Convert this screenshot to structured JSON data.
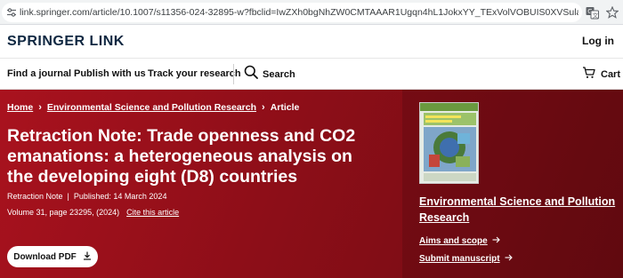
{
  "browser": {
    "url": "link.springer.com/article/10.1007/s11356-024-32895-w?fbclid=IwZXh0bgNhZW0CMTAAAR1Ugqn4hL1JokxYY_TExVolVOBUIS0XVSulaxiA_oratL5an3qFRZwtyI_aem_Acla6Zhy67Glz4Uc_iuc-zO..."
  },
  "header": {
    "logo": "SPRINGER LINK",
    "login": "Log in"
  },
  "nav": {
    "find_journal": "Find a journal",
    "publish": "Publish with us",
    "track": "Track your research",
    "search": "Search",
    "cart": "Cart"
  },
  "breadcrumb": {
    "home": "Home",
    "journal": "Environmental Science and Pollution Research",
    "current": "Article"
  },
  "article": {
    "title": "Retraction Note: Trade openness and CO2 emanations: a heterogeneous analysis on the developing eight (D8) countries",
    "type": "Retraction Note",
    "published": "Published: 14 March 2024",
    "volume": "Volume 31, page 23295, (2024)",
    "cite": "Cite this article",
    "download": "Download PDF"
  },
  "sidebar": {
    "journal_name": "Environmental Science and Pollution Research",
    "aims": "Aims and scope",
    "submit": "Submit manuscript"
  },
  "colors": {
    "hero": "#9a1019",
    "logo": "#0f2741"
  },
  "icons": [
    "tune-icon",
    "translate-icon",
    "star-icon",
    "search-icon",
    "cart-icon",
    "download-icon",
    "arrow-right-icon"
  ]
}
